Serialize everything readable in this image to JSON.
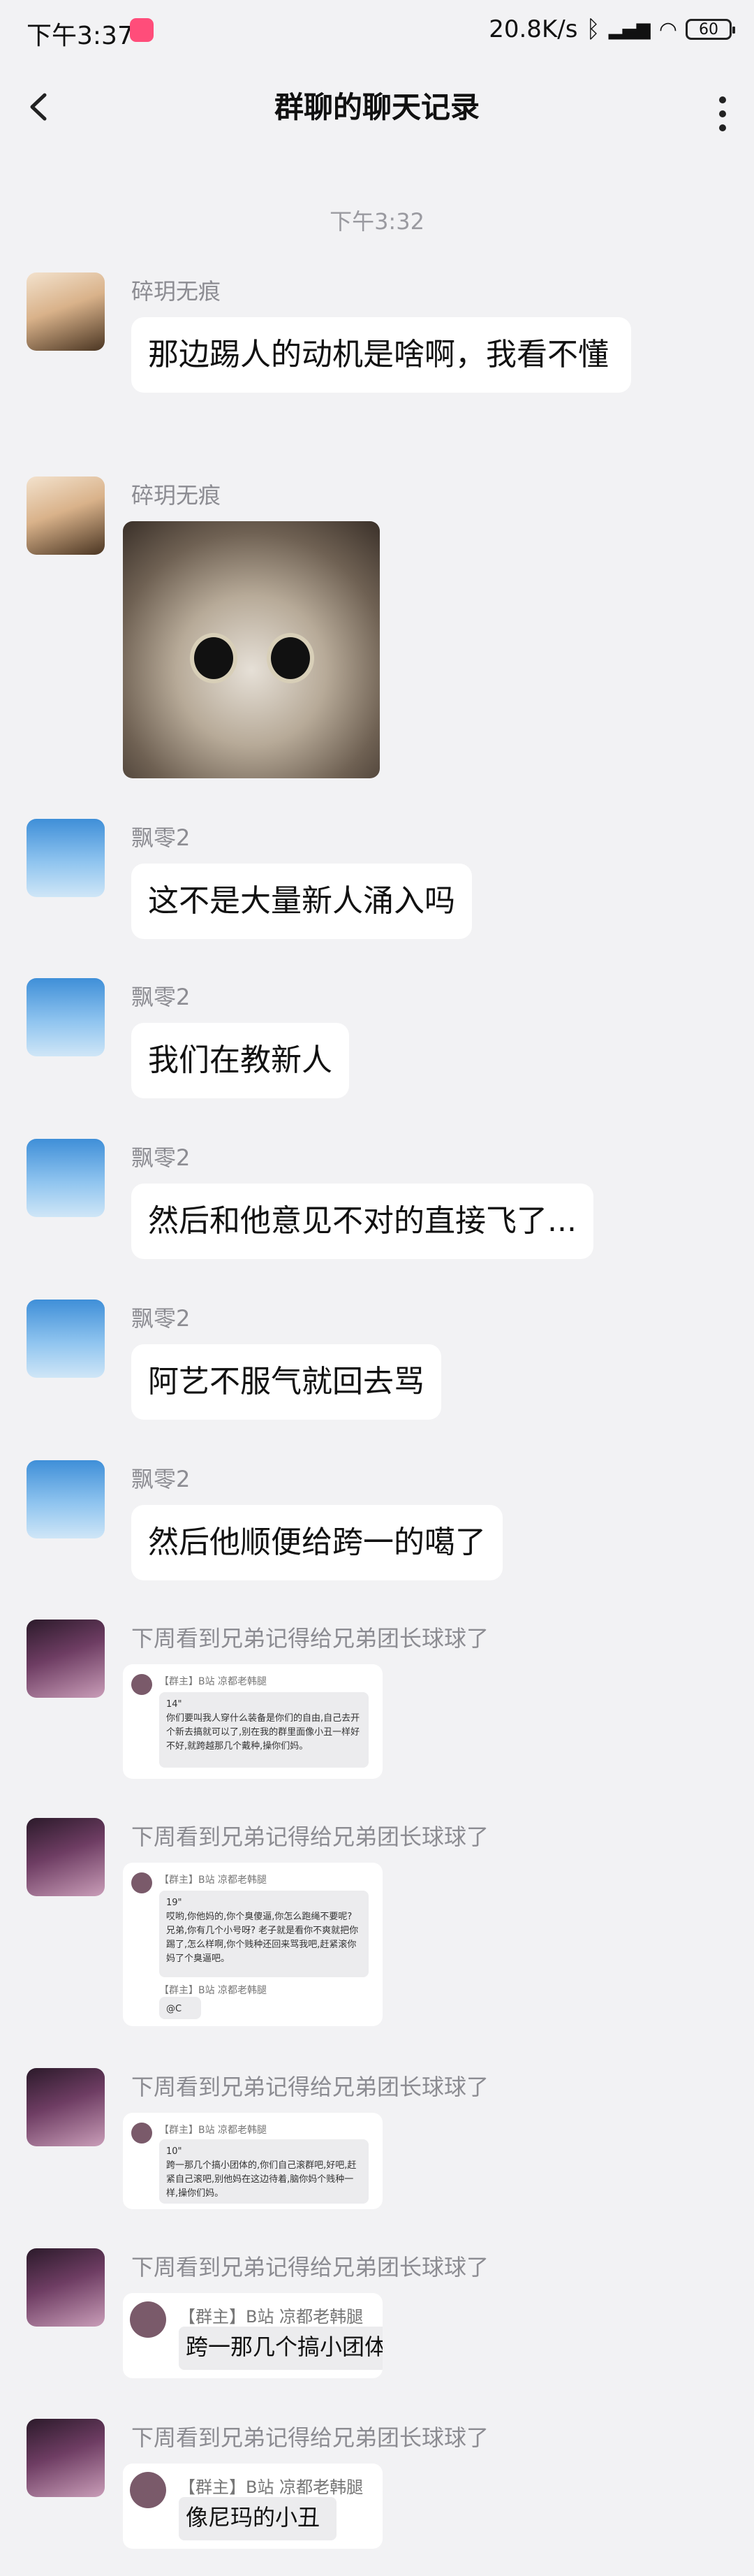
{
  "status": {
    "time": "下午3:37",
    "net_speed": "20.8K/s",
    "battery": "60"
  },
  "header": {
    "title": "群聊的聊天记录"
  },
  "timestamp": "下午3:32",
  "messages": [
    {
      "nick": "碎玥无痕",
      "text": "那边踢人的动机是啥啊，我看不懂"
    },
    {
      "nick": "碎玥无痕"
    },
    {
      "nick": "飘零2",
      "text": "这不是大量新人涌入吗"
    },
    {
      "nick": "飘零2",
      "text": "我们在教新人"
    },
    {
      "nick": "飘零2",
      "text": "然后和他意见不对的直接飞了..."
    },
    {
      "nick": "飘零2",
      "text": "阿艺不服气就回去骂"
    },
    {
      "nick": "飘零2",
      "text": "然后他顺便给跨一的噶了"
    },
    {
      "nick": "下周看到兄弟记得给兄弟团长球球了",
      "shot": {
        "name": "【群主】B站 凉都老韩腿",
        "dur": "14\"",
        "text": "你们要叫我人穿什么装备是你们的自由,自己去开个新去搞就可以了,别在我的群里面像小丑一样好不好,就跨越那几个戴种,操你们妈。"
      }
    },
    {
      "nick": "下周看到兄弟记得给兄弟团长球球了",
      "shot": {
        "name": "【群主】B站 凉都老韩腿",
        "dur": "19\"",
        "text": "哎哟,你他妈的,你个臭傻逼,你怎么跑绳不要呢? 兄弟,你有几个小号呀? 老子就是看你不爽就把你踢了,怎么样啊,你个贱种还回来骂我吧,赶紧滚你妈了个臭逼吧。",
        "name2": "【群主】B站 凉都老韩腿",
        "text2": "@C"
      }
    },
    {
      "nick": "下周看到兄弟记得给兄弟团长球球了",
      "shot": {
        "name": "【群主】B站 凉都老韩腿",
        "dur": "10\"",
        "text": "跨一那几个搞小团体的,你们自己滚群吧,好吧,赶紧自己滚吧,别他妈在这边待着,脑你妈个贱种一样,操你们妈。"
      }
    },
    {
      "nick": "下周看到兄弟记得给兄弟团长球球了",
      "shot": {
        "name": "【群主】B站 凉都老韩腿",
        "text": "跨一那几个搞小团体"
      }
    },
    {
      "nick": "下周看到兄弟记得给兄弟团长球球了",
      "shot": {
        "name": "【群主】B站 凉都老韩腿",
        "text": "像尼玛的小丑"
      }
    }
  ]
}
